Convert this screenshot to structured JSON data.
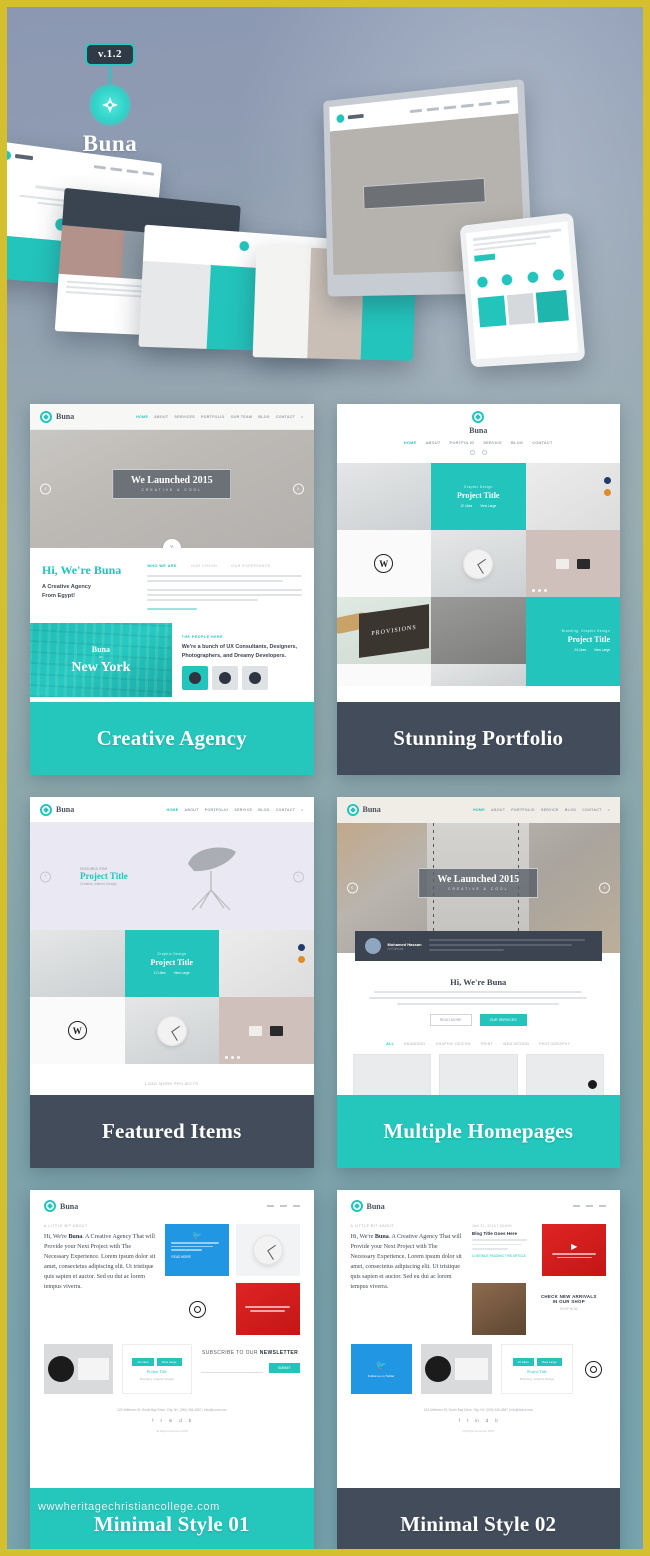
{
  "brand": {
    "version_badge": "v.1.2",
    "name": "Buna",
    "logo_icon": "diamond-star-icon"
  },
  "watermark": "wwwheritagechristiancollege.com",
  "nav": {
    "items": [
      "HOME",
      "ABOUT",
      "SERVICES",
      "PORTFOLIO",
      "OUR TEAM",
      "BLOG",
      "CONTACT"
    ],
    "items_short": [
      "HOME",
      "ABOUT",
      "PORTFOLIO",
      "SERVICE",
      "BLOG",
      "CONTACT"
    ],
    "active": "HOME",
    "search_icon": "search-icon"
  },
  "hero": {
    "slide_title": "We Launched 2015",
    "slide_subtitle": "CREATIVE & COOL",
    "prev_icon": "chevron-left-icon",
    "next_icon": "chevron-right-icon",
    "scroll_icon": "chevron-down-icon"
  },
  "panels": [
    {
      "id": "creative-agency",
      "caption": "Creative Agency",
      "caption_style": "teal",
      "intro": {
        "heading": "Hi, We're Buna",
        "subheading_line1": "A Creative Agency",
        "subheading_line2": "From Egypt!",
        "tabs": [
          "WHO WE ARE",
          "OUR VISION",
          "OUR EXPERIENCE"
        ],
        "active_tab": "WHO WE ARE",
        "link": "READ ABOUT BUNA"
      },
      "city": {
        "brand": "Buna",
        "connector": "in",
        "name": "New York"
      },
      "team": {
        "label": "THE PEOPLE HERE",
        "text": "We're a bunch of UX Consultants, Designers, Photographers, and Dreamy Developers."
      }
    },
    {
      "id": "stunning-portfolio",
      "caption": "Stunning Portfolio",
      "caption_style": "dark",
      "tiles": [
        {
          "pre": "Graphic Design",
          "title": "Project Title",
          "like_label": "12 Likes",
          "view_label": "View Large"
        },
        {
          "pre": "Branding, Graphic Design",
          "title": "Project Title",
          "like_label": "24 Likes",
          "view_label": "View Large"
        }
      ],
      "watermark_glyph": "W",
      "poster_word": "PROVISIONS"
    },
    {
      "id": "featured-items",
      "caption": "Featured Items",
      "caption_style": "dark",
      "slide": {
        "pre": "FEATURED ITEM",
        "title": "Project Title",
        "sub": "Creative, Interior Design"
      },
      "tile": {
        "pre": "Graphic Design",
        "title": "Project Title",
        "like_label": "12 Likes",
        "view_label": "View Large"
      },
      "load_more": "LOAD MORE PROJECTS"
    },
    {
      "id": "multiple-homepages",
      "caption": "Multiple Homepages",
      "caption_style": "teal",
      "testimonial": {
        "name": "Mohamed Hassan",
        "role": "Art Director"
      },
      "about": {
        "heading": "Hi, We're Buna"
      },
      "buttons": {
        "ghost": "READ MORE",
        "primary": "OUR SERVICES"
      },
      "filters": [
        "ALL",
        "BRANDING",
        "GRAPHIC DESIGN",
        "PRINT",
        "WEB DESIGN",
        "PHOTOGRAPHY"
      ],
      "active_filter": "ALL"
    },
    {
      "id": "minimal-style-01",
      "caption": "Minimal Style 01",
      "caption_style": "teal",
      "tag": "A LITTLE BIT ABOUT",
      "paragraph_lead": "Hi, We're ",
      "paragraph_brand": "Buna",
      "paragraph_rest": ". A Creative Agency That will Provide your Next Project with The Necessary Experience. Lorem ipsum dolor sit amet, consectetus adipiscing elit. Ut tristique quis sapien et auctor. Sed eu dui ac lorem tempus viverra.",
      "twitter_card": {
        "icon": "twitter-icon",
        "more": "READ MORE"
      },
      "project": {
        "title": "Project Title",
        "sub": "Branding, Graphic Design",
        "btn1": "12 Likes",
        "btn2": "View Large"
      },
      "newsletter": {
        "title_lead": "SUBSCRIBE TO OUR ",
        "title_bold": "NEWSLETTER",
        "placeholder": "Your Email",
        "button": "SUBMIT"
      },
      "footer": {
        "address": "125 Jefferson St, South Bay Drive, City, NY, (090) 345-4567 | info@buna.com",
        "socials": [
          "f",
          "t",
          "in",
          "d",
          "b"
        ],
        "copyright": "All Rights Reserved 2015"
      }
    },
    {
      "id": "minimal-style-02",
      "caption": "Minimal Style 02",
      "caption_style": "dark",
      "tag": "A LITTLE BIT ABOUT",
      "paragraph_lead": "Hi, We're ",
      "paragraph_brand": "Buna",
      "paragraph_rest": ". A Creative Agency That will Provide your Next Project with The Necessary Experience. Lorem ipsum dolor sit amet, consectetus adipiscing elit. Ut tristique quis sapien et auctor. Sed eu dui ac lorem tempus viverra.",
      "blog": {
        "meta": "JAN 21, 2015   |   ADMIN",
        "heading": "Blog Title Goes Here",
        "more": "CONTINUE READING THIS ARTICLE"
      },
      "arrivals": {
        "line1": "CHECK NEW ARRIVALS",
        "line2": "IN OUR SHOP",
        "link": "SHOP NOW"
      },
      "twitter_card": {
        "icon": "twitter-icon",
        "caption": "Follow us on Twitter"
      },
      "project": {
        "title": "Project Title",
        "sub": "Branding, Graphic Design",
        "btn1": "12 Likes",
        "btn2": "View Large"
      },
      "footer": {
        "address": "125 Jefferson St, South Bay Drive, City, NY, (090) 345-4567 | info@buna.com",
        "socials": [
          "f",
          "t",
          "in",
          "d",
          "b"
        ],
        "copyright": "All Rights Reserved 2015"
      }
    }
  ],
  "colors": {
    "teal": "#22c4bb",
    "dark": "#424c5a",
    "gold_border": "#d4bf2e",
    "blue": "#2196e3",
    "red": "#d41f1f"
  }
}
